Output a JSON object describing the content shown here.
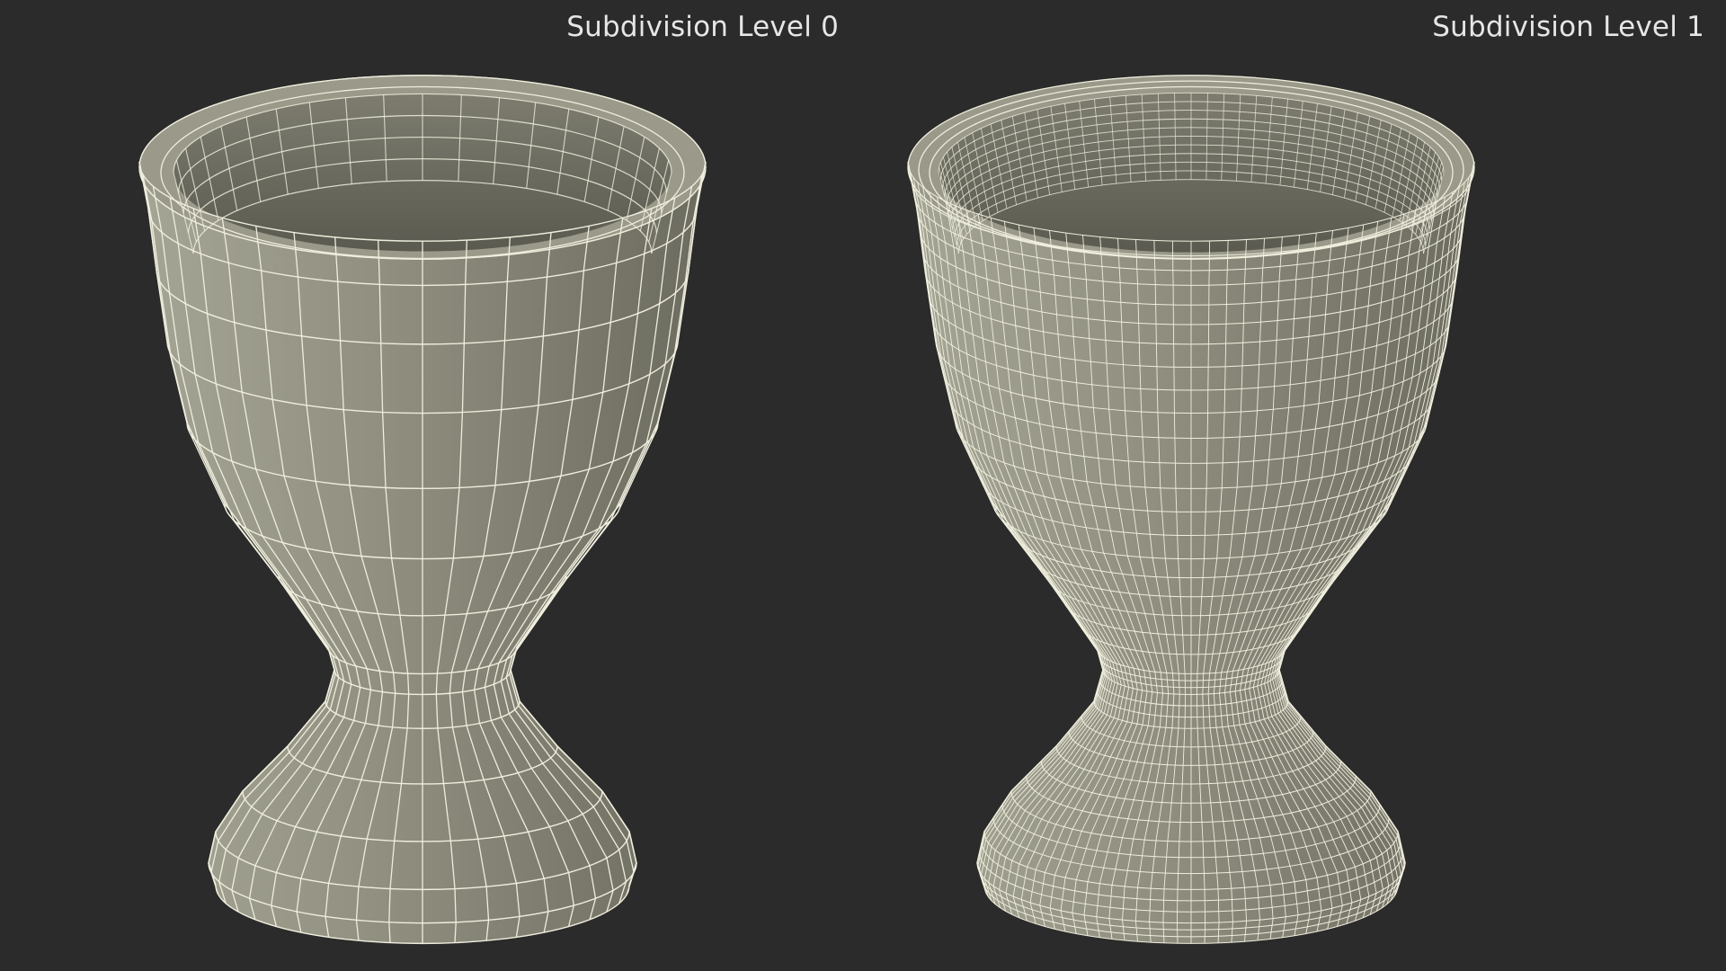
{
  "viewer": {
    "background_color": "#2b2b2b",
    "mesh_fill_color": "#8c8b7c",
    "wire_color": "#efeedd",
    "label_color": "#e6e6e6"
  },
  "panels": [
    {
      "label": "Subdivision Level 0",
      "subdivision_level": 0,
      "object": "egg-cup-mesh"
    },
    {
      "label": "Subdivision Level 1",
      "subdivision_level": 1,
      "object": "egg-cup-mesh"
    }
  ]
}
